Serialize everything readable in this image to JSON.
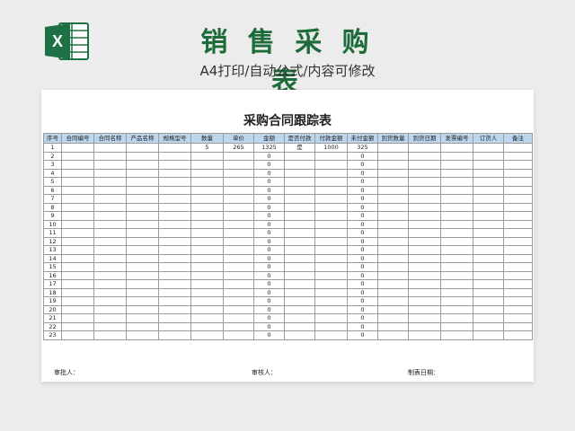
{
  "banner": {
    "title": "销 售 采 购 表",
    "subtitle": "A4打印/自动公式/内容可修改"
  },
  "sheet": {
    "title": "采购合同跟踪表",
    "columns": [
      "序号",
      "合同编号",
      "合同名称",
      "产品名称",
      "规格型号",
      "数量",
      "单价",
      "金额",
      "是否付款",
      "付款金额",
      "未付金额",
      "到货数量",
      "到货日期",
      "发票编号",
      "订货人",
      "备注"
    ],
    "rows": [
      [
        "1",
        "",
        "",
        "",
        "",
        "5",
        "265",
        "1325",
        "是",
        "1000",
        "325",
        "",
        "",
        "",
        "",
        ""
      ],
      [
        "2",
        "",
        "",
        "",
        "",
        "",
        "",
        "0",
        "",
        "",
        "0",
        "",
        "",
        "",
        "",
        ""
      ],
      [
        "3",
        "",
        "",
        "",
        "",
        "",
        "",
        "0",
        "",
        "",
        "0",
        "",
        "",
        "",
        "",
        ""
      ],
      [
        "4",
        "",
        "",
        "",
        "",
        "",
        "",
        "0",
        "",
        "",
        "0",
        "",
        "",
        "",
        "",
        ""
      ],
      [
        "5",
        "",
        "",
        "",
        "",
        "",
        "",
        "0",
        "",
        "",
        "0",
        "",
        "",
        "",
        "",
        ""
      ],
      [
        "6",
        "",
        "",
        "",
        "",
        "",
        "",
        "0",
        "",
        "",
        "0",
        "",
        "",
        "",
        "",
        ""
      ],
      [
        "7",
        "",
        "",
        "",
        "",
        "",
        "",
        "0",
        "",
        "",
        "0",
        "",
        "",
        "",
        "",
        ""
      ],
      [
        "8",
        "",
        "",
        "",
        "",
        "",
        "",
        "0",
        "",
        "",
        "0",
        "",
        "",
        "",
        "",
        ""
      ],
      [
        "9",
        "",
        "",
        "",
        "",
        "",
        "",
        "0",
        "",
        "",
        "0",
        "",
        "",
        "",
        "",
        ""
      ],
      [
        "10",
        "",
        "",
        "",
        "",
        "",
        "",
        "0",
        "",
        "",
        "0",
        "",
        "",
        "",
        "",
        ""
      ],
      [
        "11",
        "",
        "",
        "",
        "",
        "",
        "",
        "0",
        "",
        "",
        "0",
        "",
        "",
        "",
        "",
        ""
      ],
      [
        "12",
        "",
        "",
        "",
        "",
        "",
        "",
        "0",
        "",
        "",
        "0",
        "",
        "",
        "",
        "",
        ""
      ],
      [
        "13",
        "",
        "",
        "",
        "",
        "",
        "",
        "0",
        "",
        "",
        "0",
        "",
        "",
        "",
        "",
        ""
      ],
      [
        "14",
        "",
        "",
        "",
        "",
        "",
        "",
        "0",
        "",
        "",
        "0",
        "",
        "",
        "",
        "",
        ""
      ],
      [
        "15",
        "",
        "",
        "",
        "",
        "",
        "",
        "0",
        "",
        "",
        "0",
        "",
        "",
        "",
        "",
        ""
      ],
      [
        "16",
        "",
        "",
        "",
        "",
        "",
        "",
        "0",
        "",
        "",
        "0",
        "",
        "",
        "",
        "",
        ""
      ],
      [
        "17",
        "",
        "",
        "",
        "",
        "",
        "",
        "0",
        "",
        "",
        "0",
        "",
        "",
        "",
        "",
        ""
      ],
      [
        "18",
        "",
        "",
        "",
        "",
        "",
        "",
        "0",
        "",
        "",
        "0",
        "",
        "",
        "",
        "",
        ""
      ],
      [
        "19",
        "",
        "",
        "",
        "",
        "",
        "",
        "0",
        "",
        "",
        "0",
        "",
        "",
        "",
        "",
        ""
      ],
      [
        "20",
        "",
        "",
        "",
        "",
        "",
        "",
        "0",
        "",
        "",
        "0",
        "",
        "",
        "",
        "",
        ""
      ],
      [
        "21",
        "",
        "",
        "",
        "",
        "",
        "",
        "0",
        "",
        "",
        "0",
        "",
        "",
        "",
        "",
        ""
      ],
      [
        "22",
        "",
        "",
        "",
        "",
        "",
        "",
        "0",
        "",
        "",
        "0",
        "",
        "",
        "",
        "",
        ""
      ],
      [
        "23",
        "",
        "",
        "",
        "",
        "",
        "",
        "0",
        "",
        "",
        "0",
        "",
        "",
        "",
        "",
        ""
      ]
    ],
    "footer": {
      "approver": "审批人：",
      "reviewer": "审核人：",
      "prepared_date": "制表日期："
    }
  },
  "logo": {
    "icon": "excel-icon",
    "letter": "X",
    "color": "#1e7145"
  }
}
